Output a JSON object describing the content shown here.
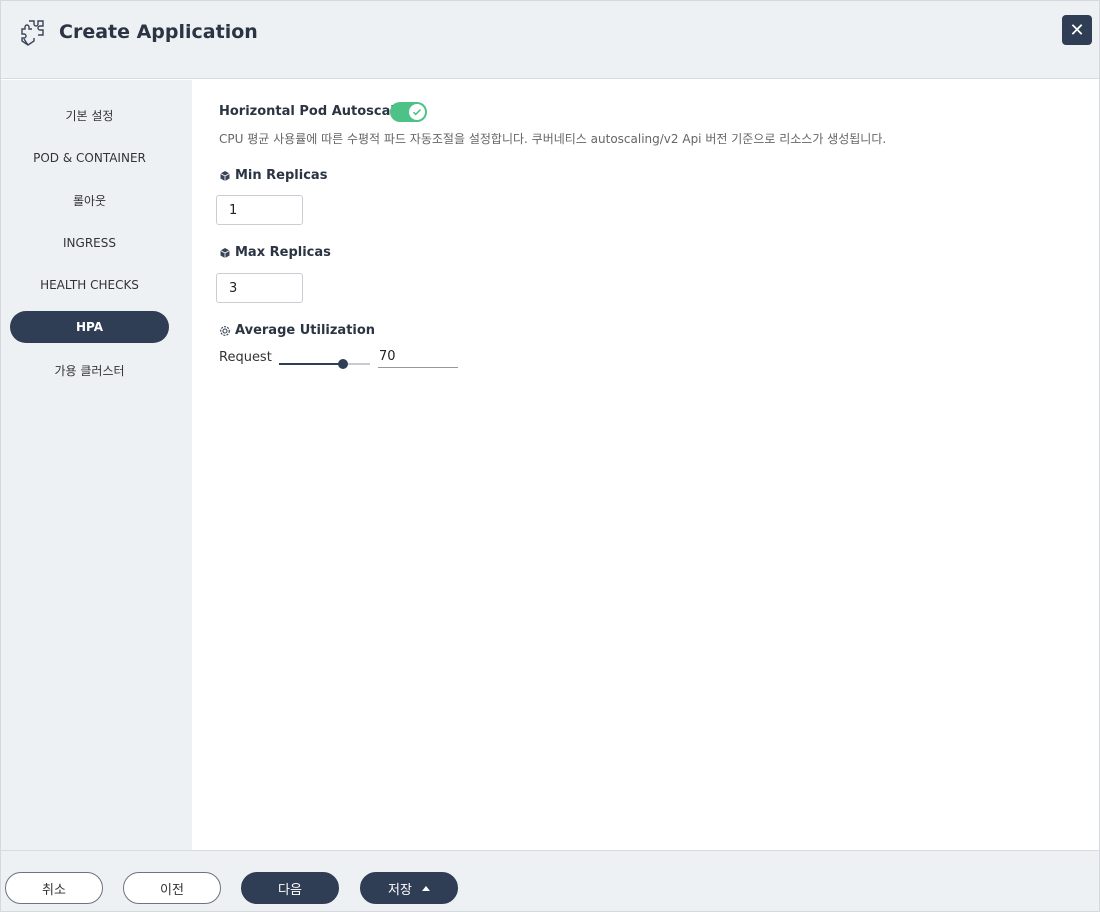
{
  "header": {
    "title": "Create Application",
    "app_icon": "puzzle-icon",
    "close_label": "✕"
  },
  "sidebar": {
    "items": [
      {
        "label": "기본 설정",
        "active": false
      },
      {
        "label": "POD & CONTAINER",
        "active": false
      },
      {
        "label": "롤아웃",
        "active": false
      },
      {
        "label": "INGRESS",
        "active": false
      },
      {
        "label": "HEALTH CHECKS",
        "active": false
      },
      {
        "label": "HPA",
        "active": true
      },
      {
        "label": "가용 클러스터",
        "active": false
      }
    ]
  },
  "main": {
    "hpa_title": "Horizontal Pod Autoscaling",
    "toggle_on": true,
    "description": "CPU 평균 사용률에 따른 수평적 파드 자동조절을 설정합니다. 쿠버네티스 autoscaling/v2 Api 버전 기준으로 리소스가 생성됩니다.",
    "min_replicas": {
      "label": "Min Replicas",
      "value": "1"
    },
    "max_replicas": {
      "label": "Max Replicas",
      "value": "3"
    },
    "average_utilization": {
      "label": "Average Utilization",
      "request_label": "Request",
      "slider_fraction": 0.7,
      "value": "70"
    }
  },
  "footer": {
    "cancel": "취소",
    "prev": "이전",
    "next": "다음",
    "save": "저장"
  },
  "colors": {
    "primary": "#2f3d55",
    "toggle": "#4cc287",
    "panel_bg": "#eef1f4"
  }
}
